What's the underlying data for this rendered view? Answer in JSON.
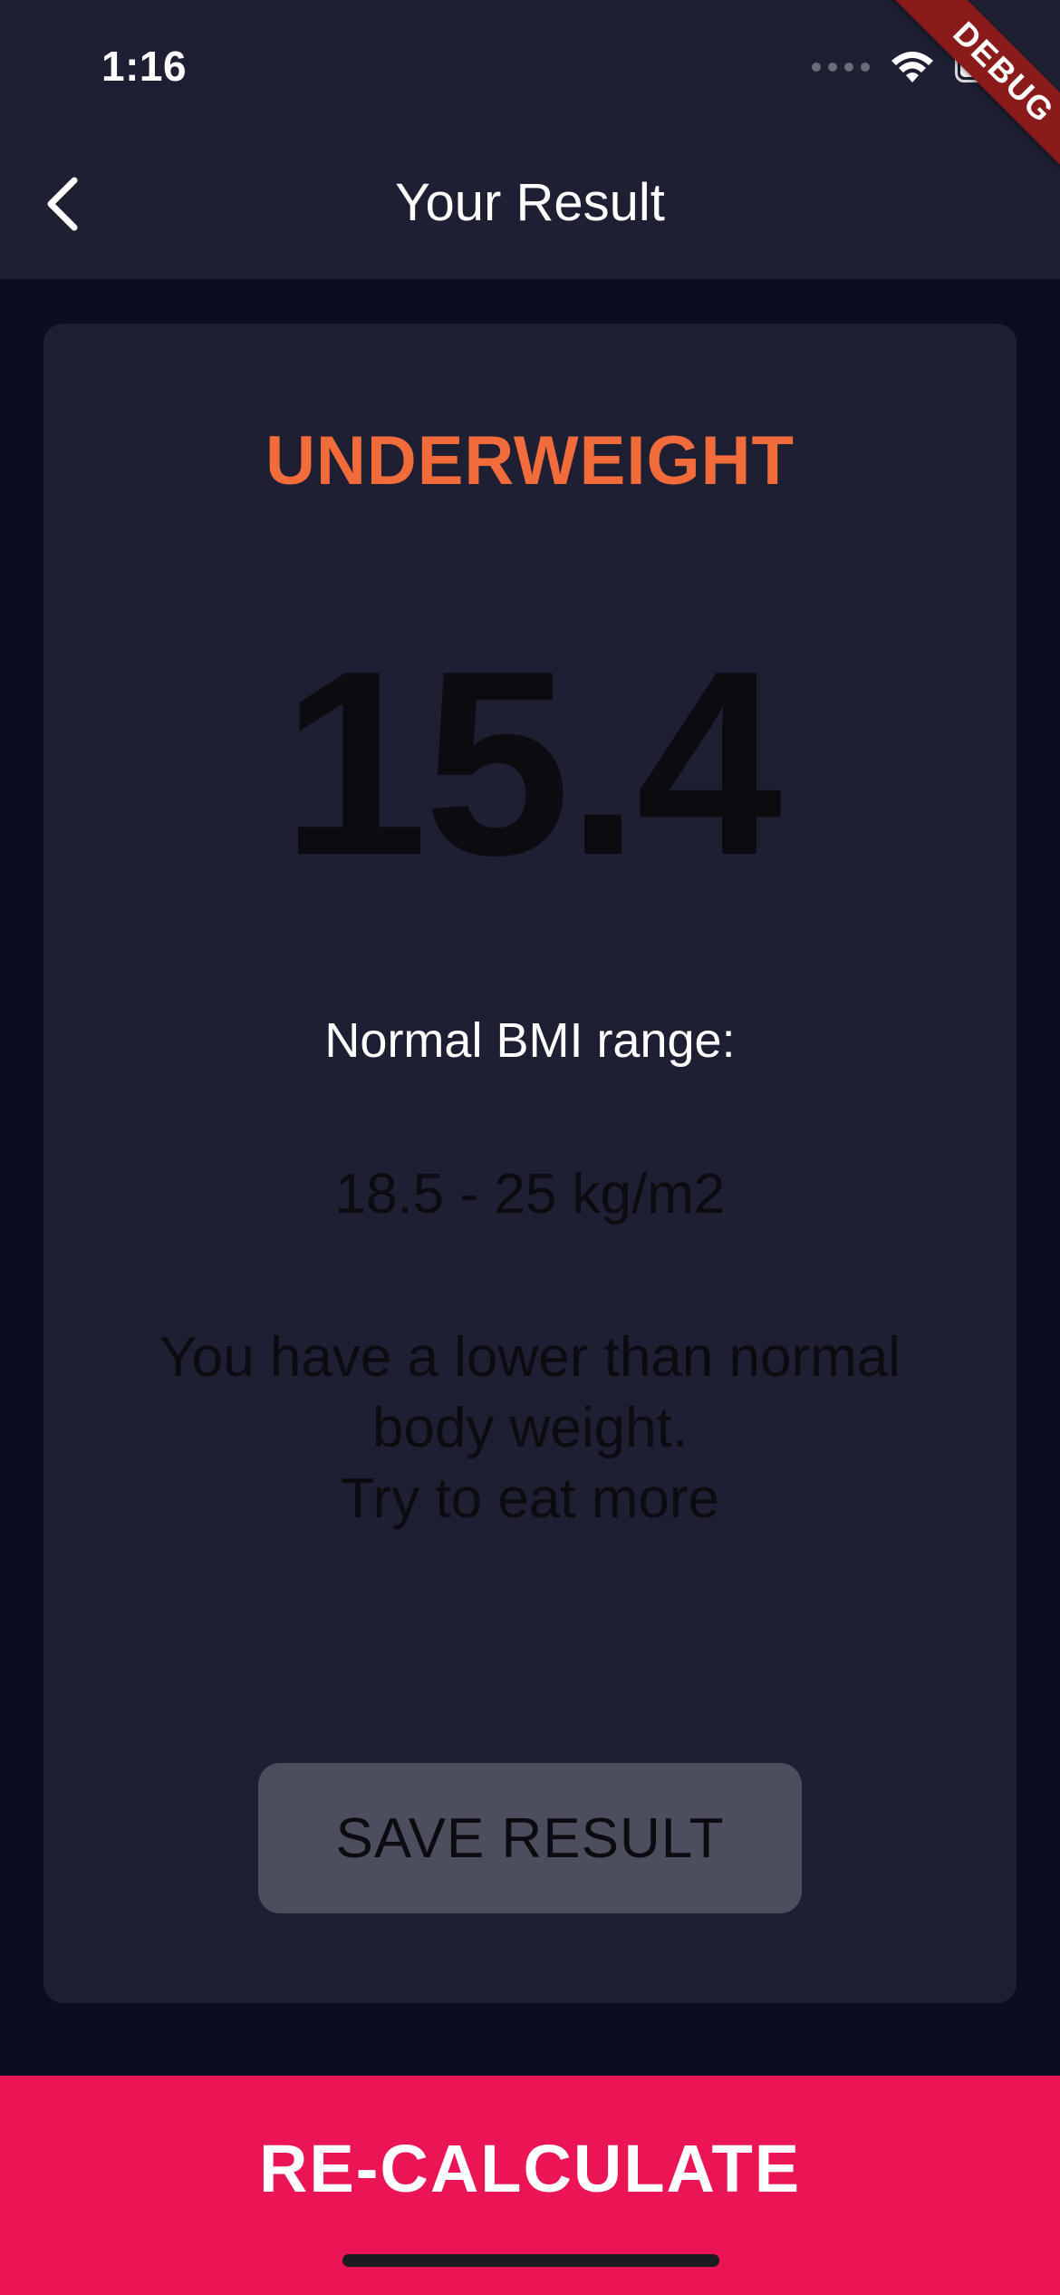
{
  "status_bar": {
    "time": "1:16",
    "debug_banner": "DEBUG",
    "icons": [
      "signal-icon",
      "wifi-icon",
      "battery-icon"
    ]
  },
  "app_bar": {
    "back_icon": "chevron-left-icon",
    "title": "Your Result"
  },
  "result": {
    "category": "UNDERWEIGHT",
    "bmi": "15.4",
    "normal_range_label": "Normal BMI range:",
    "normal_range_value": "18.5 - 25 kg/m2",
    "advice": "You have a lower than normal\nbody weight.\nTry to eat more",
    "save_label": "SAVE RESULT"
  },
  "footer": {
    "recalculate_label": "RE-CALCULATE"
  },
  "colors": {
    "background": "#0b0e1e",
    "card": "#1e1f33",
    "category": "#f26b3a",
    "save_button": "#4c4e5e",
    "recalculate": "#eb1555"
  }
}
